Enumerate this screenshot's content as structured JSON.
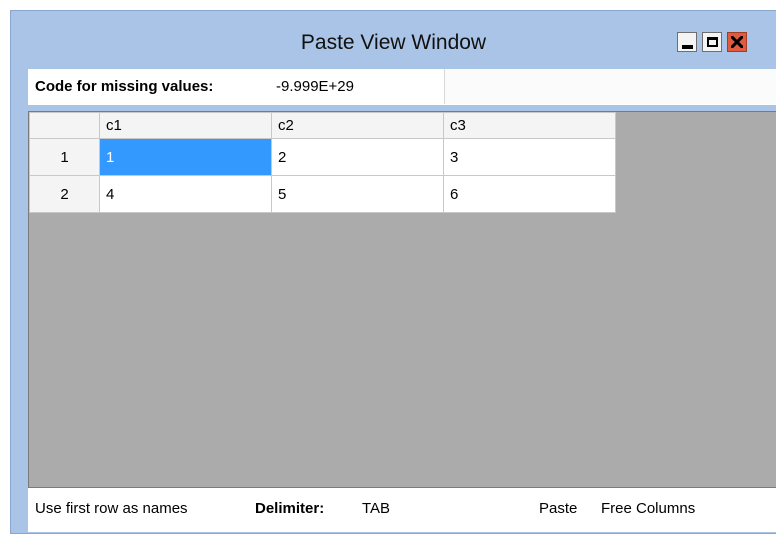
{
  "window": {
    "title": "Paste View Window"
  },
  "missing": {
    "label": "Code for missing values:",
    "value": "-9.999E+29"
  },
  "grid": {
    "columns": [
      "c1",
      "c2",
      "c3"
    ],
    "rows": [
      {
        "header": "1",
        "cells": [
          "1",
          "2",
          "3"
        ]
      },
      {
        "header": "2",
        "cells": [
          "4",
          "5",
          "6"
        ]
      }
    ],
    "selected_cell": "1"
  },
  "status": {
    "first_row_option": "Use first row as names",
    "delimiter_label": "Delimiter:",
    "delimiter_value": "TAB",
    "paste_label": "Paste",
    "free_columns_label": "Free Columns"
  },
  "colors": {
    "title_bar": "#a9c4e6",
    "grid_background": "#ababab",
    "selection": "#3399ff",
    "close_button": "#e05a3f"
  },
  "icons": [
    "minimize-icon",
    "maximize-icon",
    "close-icon"
  ]
}
